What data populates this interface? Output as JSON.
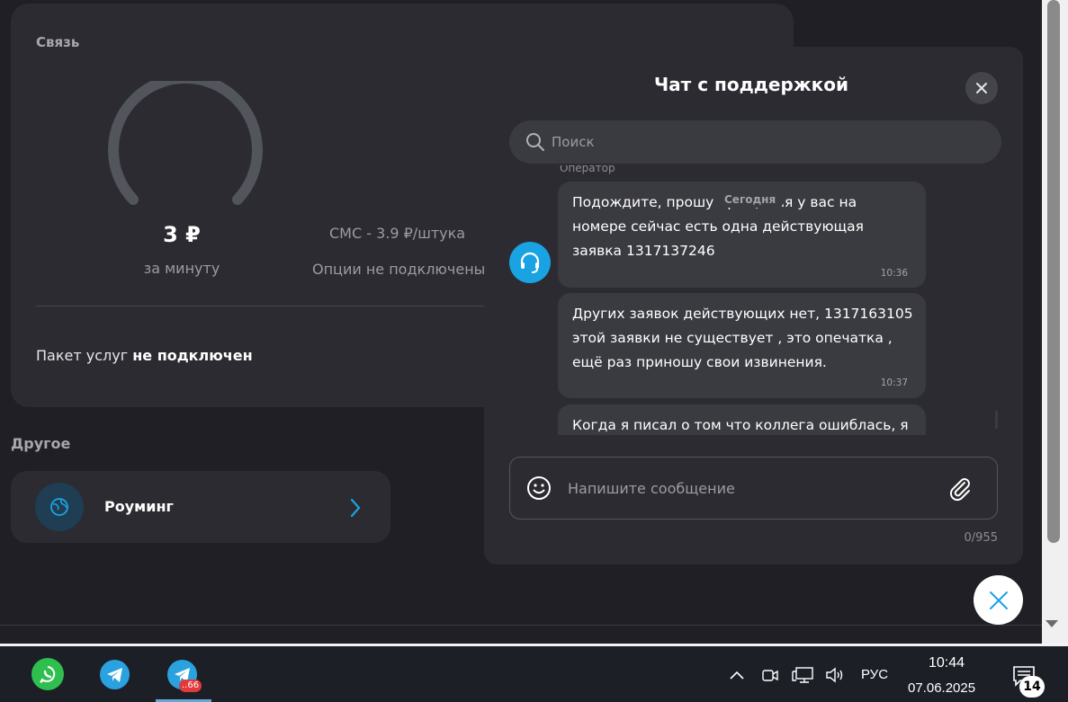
{
  "svyaz": {
    "title": "Связь",
    "price": "3 ₽",
    "price_unit": "за минуту",
    "sms": "СМС - 3.9 ₽/штука",
    "options": "Опции не подключены",
    "package_prefix": "Пакет услуг",
    "package_status": "не подключен"
  },
  "other": {
    "title": "Другое",
    "roaming_label": "Роуминг"
  },
  "chat": {
    "title": "Чат с поддержкой",
    "search_placeholder": "Поиск",
    "operator_label": "Оператор",
    "today_badge": "Сегодня",
    "messages": [
      {
        "text": "Подождите, прошу прощения у вас на номере сейчас есть одна действующая заявка 1317137246",
        "time": "10:36"
      },
      {
        "text": "Других заявок действующих нет, 1317163105 этой заявки не существует , это опечатка , ещё раз приношу свои извинения.",
        "time": "10:37"
      },
      {
        "text": "Когда я писал о том что коллега ошиблась, я",
        "time": ""
      }
    ],
    "input_placeholder": "Напишите сообщение",
    "char_count": "0/955"
  },
  "taskbar": {
    "tg_badge": "..66",
    "lang": "РУС",
    "time": "10:44",
    "date": "07.06.2025",
    "notifications": "14"
  }
}
